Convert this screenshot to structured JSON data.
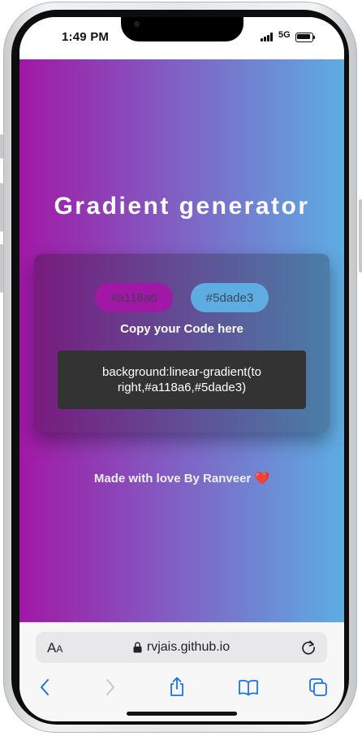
{
  "status": {
    "time": "1:49 PM",
    "network": "5G"
  },
  "page": {
    "title": "Gradient generator",
    "color1": {
      "value": "#a118a6",
      "color": "#a118a6"
    },
    "color2": {
      "value": "#5dade3",
      "color": "#5dade3"
    },
    "copy_label": "Copy your Code here",
    "code": "background:linear-gradient(to right,#a118a6,#5dade3)",
    "footer_text": "Made with love By Ranveer",
    "footer_heart": "❤️"
  },
  "safari": {
    "text_size_button": "AA",
    "url": "rvjais.github.io",
    "icons": [
      "text-size-icon",
      "lock-icon",
      "reload-icon",
      "back-icon",
      "forward-icon",
      "share-icon",
      "bookmarks-icon",
      "tabs-icon"
    ]
  },
  "colors": {
    "accent": "#1a73e8",
    "disabled": "#c7c7cc",
    "code_bg": "#333333"
  }
}
